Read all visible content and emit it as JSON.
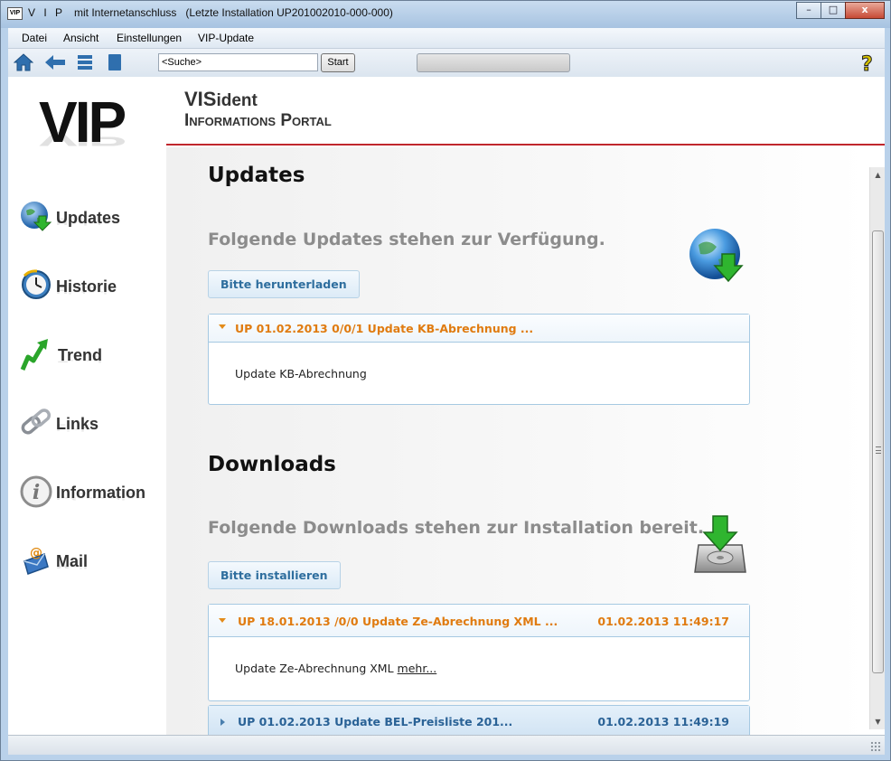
{
  "window": {
    "app_badge": "VIP",
    "title_app": "V I P",
    "title_rest": "mit Internetanschluss   (Letzte Installation UP201002010-000-000)",
    "controls": {
      "minimize": "–",
      "maximize": "□",
      "close": "x"
    }
  },
  "menu": {
    "items": [
      "Datei",
      "Ansicht",
      "Einstellungen",
      "VIP-Update"
    ]
  },
  "toolbar": {
    "icons": [
      "home-icon",
      "back-arrow-icon",
      "list-icon",
      "page-icon"
    ],
    "search_value": "<Suche>",
    "start_label": "Start",
    "help_icon": "help-question-icon"
  },
  "nav": {
    "logo": "VIP",
    "items": [
      {
        "label": "Updates",
        "icon": "globe-download-icon"
      },
      {
        "label": "Historie",
        "icon": "clock-icon"
      },
      {
        "label": "Trend",
        "icon": "trend-arrow-icon"
      },
      {
        "label": "Links",
        "icon": "chain-link-icon"
      },
      {
        "label": "Information",
        "icon": "info-icon"
      },
      {
        "label": "Mail",
        "icon": "mail-icon"
      }
    ]
  },
  "header": {
    "brand_line1_prefix": "VIS",
    "brand_line1_suffix": "ident",
    "brand_line2": "Informations Portal"
  },
  "updates": {
    "title": "Updates",
    "subtitle": "Folgende Updates stehen zur Verfügung.",
    "button": "Bitte herunterladen",
    "items": [
      {
        "title": "UP 01.02.2013 0/0/1 Update KB-Abrechnung ...",
        "body": "Update KB-Abrechnung",
        "expanded": true
      }
    ]
  },
  "downloads": {
    "title": "Downloads",
    "subtitle": "Folgende Downloads stehen zur Installation bereit.",
    "button": "Bitte installieren",
    "items": [
      {
        "title": "UP 18.01.2013 /0/0 Update Ze-Abrechnung XML ...",
        "date": "01.02.2013 11:49:17",
        "body": "Update Ze-Abrechnung XML",
        "more": "mehr...",
        "expanded": true
      },
      {
        "title": "UP 01.02.2013 Update BEL-Preisliste 201...",
        "date": "01.02.2013 11:49:19",
        "expanded": false
      }
    ]
  },
  "colors": {
    "accent_red": "#c0272d",
    "accordion_orange": "#e07b10",
    "accordion_blue": "#2a6296",
    "button_text": "#2e6e9e"
  }
}
